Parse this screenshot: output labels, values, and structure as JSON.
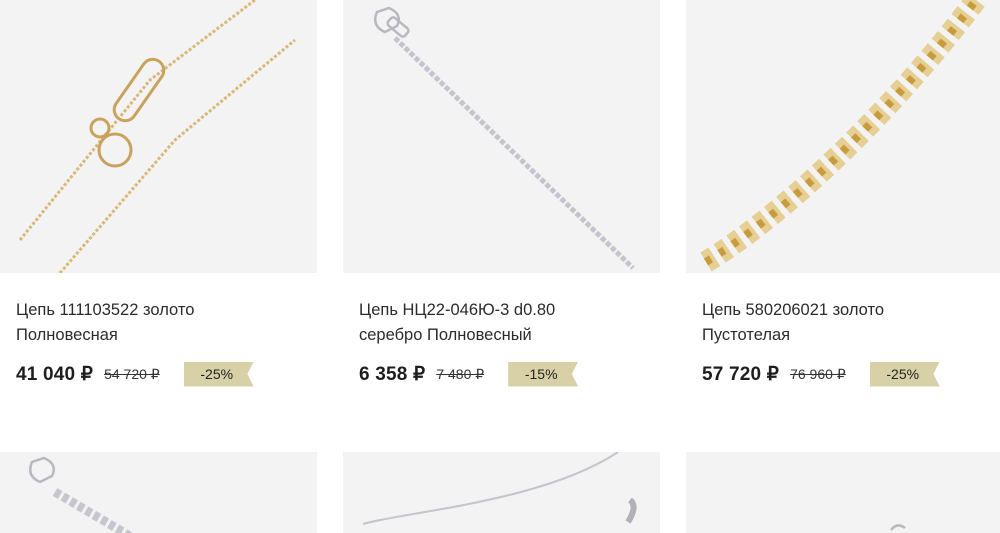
{
  "products": [
    {
      "title_line1": "Цепь 111103522 золото",
      "title_line2": "Полновесная",
      "price": "41 040 ₽",
      "old_price": "54 720 ₽",
      "discount": "-25%"
    },
    {
      "title_line1": "Цепь НЦ22-046Ю-3 d0.80",
      "title_line2": "серебро Полновесный",
      "price": "6 358 ₽",
      "old_price": "7 480 ₽",
      "discount": "-15%"
    },
    {
      "title_line1": "Цепь 580206021 золото",
      "title_line2": "Пустотелая",
      "price": "57 720 ₽",
      "old_price": "76 960 ₽",
      "discount": "-25%"
    }
  ],
  "colors": {
    "image_bg": "#f3f3f3",
    "discount_bg": "#d8d1a7",
    "gold": "#d9b877",
    "silver": "#c9c9cf"
  },
  "icons": {
    "card1": "gold-chain-thin-image",
    "card2": "silver-chain-image",
    "card3": "gold-chain-thick-image",
    "card4": "silver-chain-image",
    "card5": "silver-chain-image",
    "card6": "silver-chain-image"
  }
}
